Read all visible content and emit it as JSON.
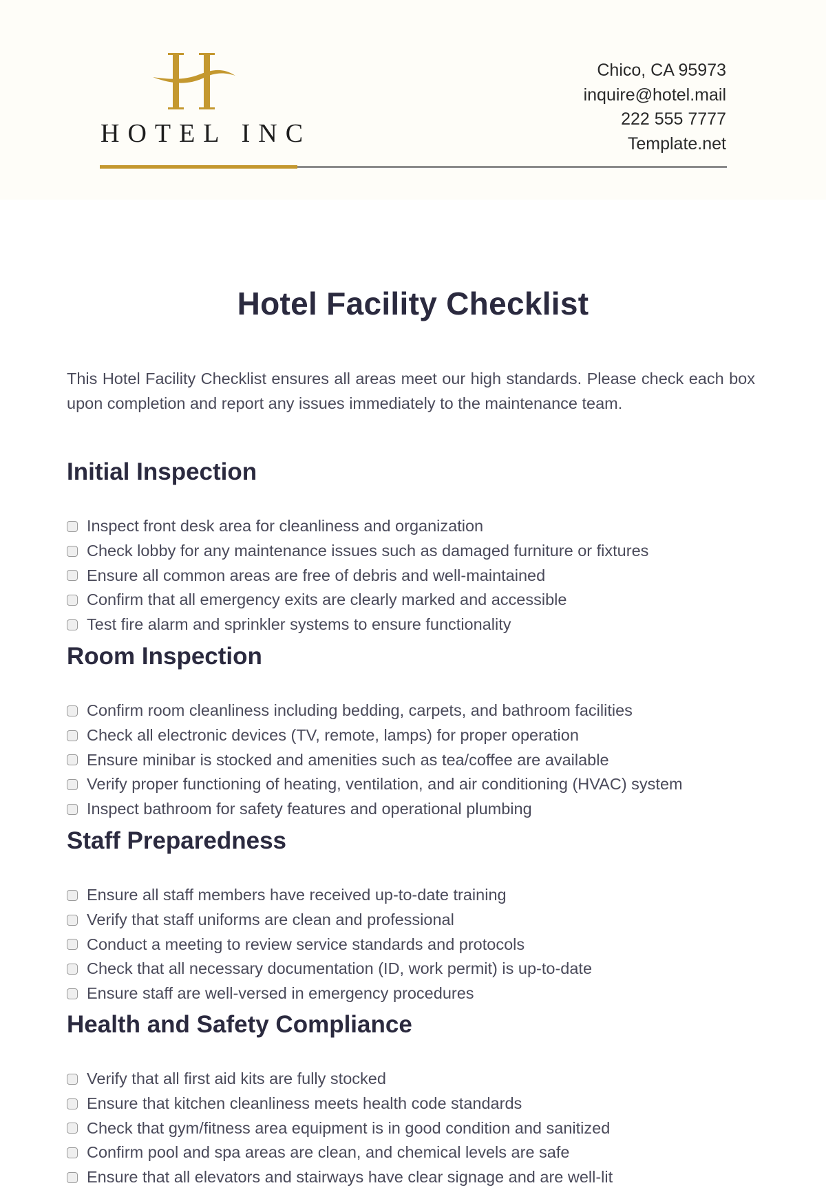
{
  "header": {
    "company_name": "HOTEL INC",
    "logo_icon": "h-monogram-icon",
    "contact": {
      "address": "Chico, CA 95973",
      "email": "inquire@hotel.mail",
      "phone": "222 555 7777",
      "website": "Template.net"
    },
    "accent_color": "#c4982f",
    "rule_color": "#8a8a8a"
  },
  "document": {
    "title": "Hotel Facility Checklist",
    "intro": "This Hotel Facility Checklist ensures all areas meet our high standards. Please check each box upon completion and report any issues immediately to the maintenance team."
  },
  "sections": [
    {
      "heading": "Initial Inspection",
      "items": [
        {
          "label": "Inspect front desk area for cleanliness and organization",
          "checked": false
        },
        {
          "label": "Check lobby for any maintenance issues such as damaged furniture or fixtures",
          "checked": false
        },
        {
          "label": "Ensure all common areas are free of debris and well-maintained",
          "checked": false
        },
        {
          "label": "Confirm that all emergency exits are clearly marked and accessible",
          "checked": false
        },
        {
          "label": "Test fire alarm and sprinkler systems to ensure functionality",
          "checked": false
        }
      ]
    },
    {
      "heading": "Room Inspection",
      "items": [
        {
          "label": "Confirm room cleanliness including bedding, carpets, and bathroom facilities",
          "checked": false
        },
        {
          "label": "Check all electronic devices (TV, remote, lamps) for proper operation",
          "checked": false
        },
        {
          "label": "Ensure minibar is stocked and amenities such as tea/coffee are available",
          "checked": false
        },
        {
          "label": "Verify proper functioning of heating, ventilation, and air conditioning (HVAC) system",
          "checked": false
        },
        {
          "label": "Inspect bathroom for safety features and operational plumbing",
          "checked": false
        }
      ]
    },
    {
      "heading": "Staff Preparedness",
      "items": [
        {
          "label": "Ensure all staff members have received up-to-date training",
          "checked": false
        },
        {
          "label": "Verify that staff uniforms are clean and professional",
          "checked": false
        },
        {
          "label": "Conduct a meeting to review service standards and protocols",
          "checked": false
        },
        {
          "label": "Check that all necessary documentation (ID, work permit) is up-to-date",
          "checked": false
        },
        {
          "label": "Ensure staff are well-versed in emergency procedures",
          "checked": false
        }
      ]
    },
    {
      "heading": "Health and Safety Compliance",
      "items": [
        {
          "label": "Verify that all first aid kits are fully stocked",
          "checked": false
        },
        {
          "label": "Ensure that kitchen cleanliness meets health code standards",
          "checked": false
        },
        {
          "label": "Check that gym/fitness area equipment is in good condition and sanitized",
          "checked": false
        },
        {
          "label": "Confirm pool and spa areas are clean, and chemical levels are safe",
          "checked": false
        },
        {
          "label": "Ensure that all elevators and stairways have clear signage and are well-lit",
          "checked": false
        }
      ]
    }
  ]
}
